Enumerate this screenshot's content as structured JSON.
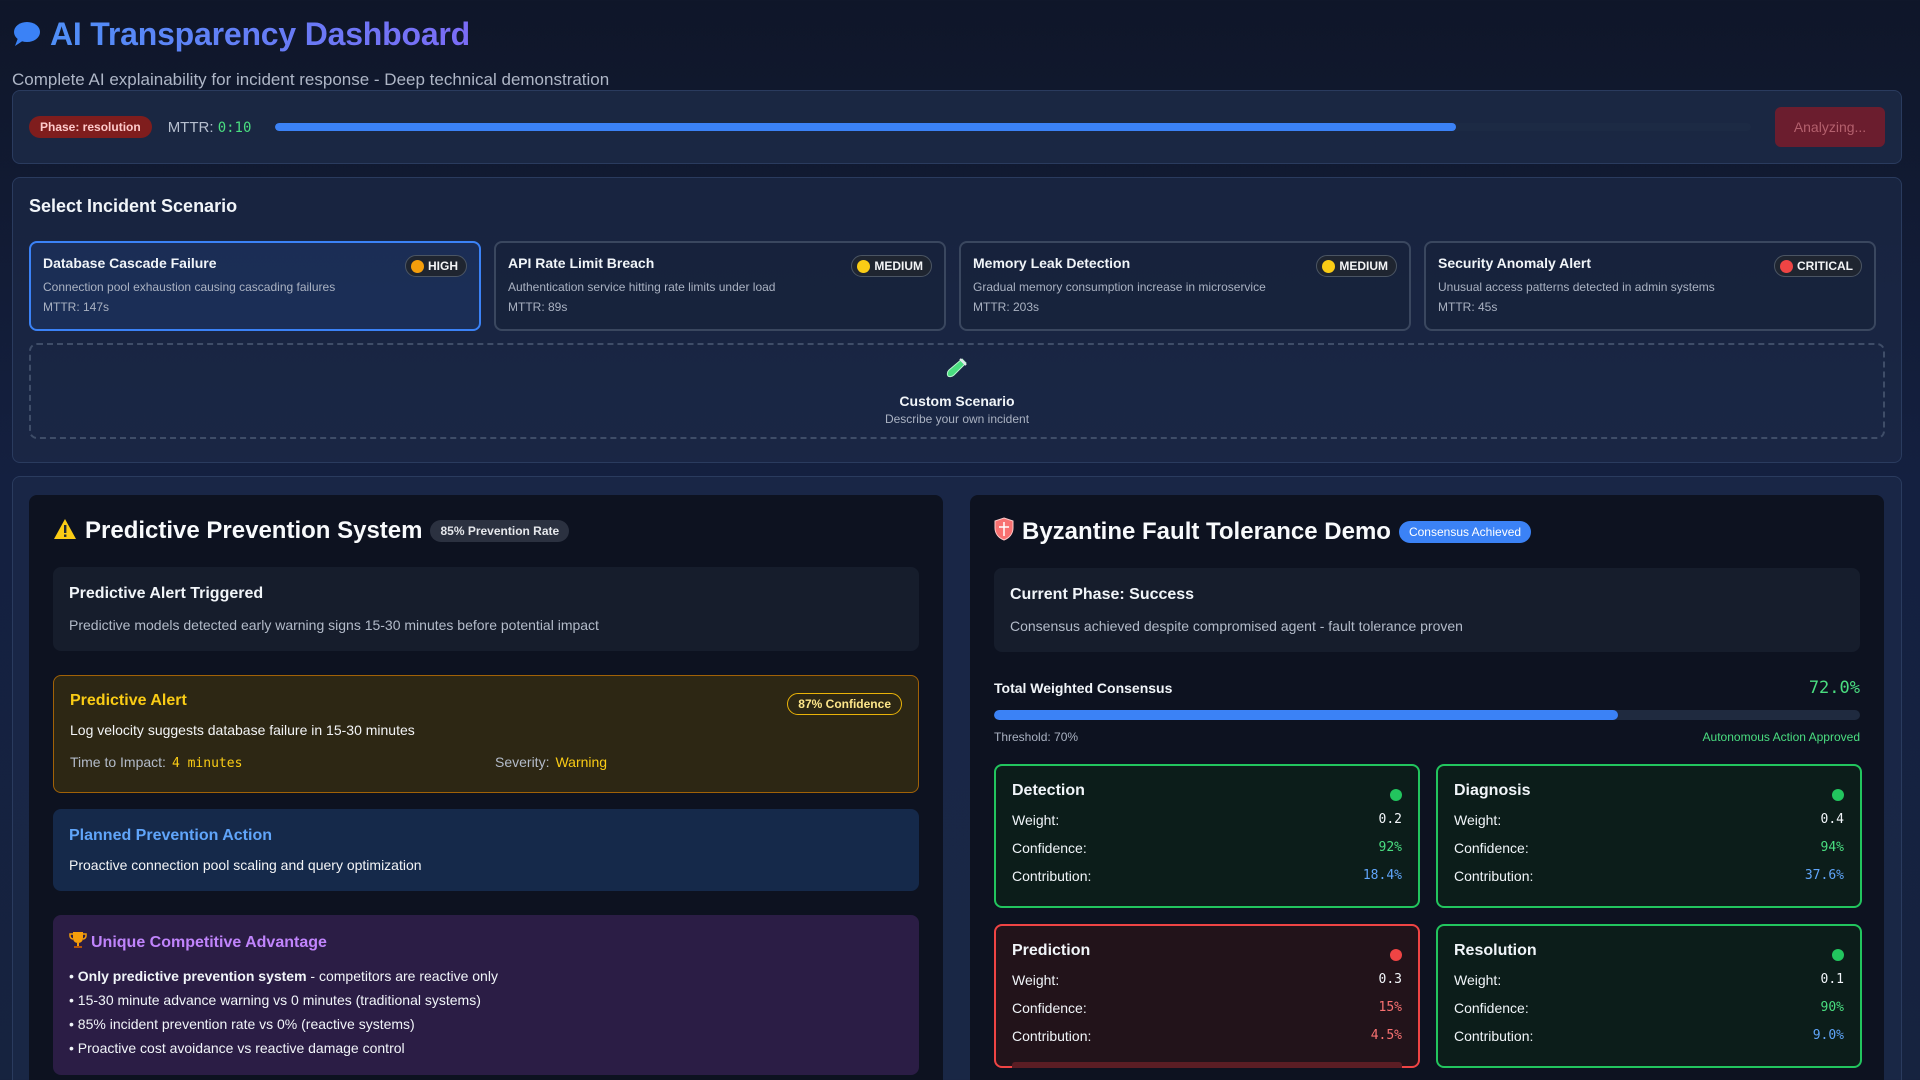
{
  "header": {
    "title": "AI Transparency Dashboard",
    "subtitle": "Complete AI explainability for incident response - Deep technical demonstration",
    "icon": "speech-bubble-icon"
  },
  "status": {
    "phase_badge": "Phase: resolution",
    "mttr_label": "MTTR:",
    "mttr_value": "0:10",
    "progress": 0.8,
    "button_label": "Analyzing..."
  },
  "scenarios": {
    "title": "Select Incident Scenario",
    "items": [
      {
        "title": "Database Cascade Failure",
        "severity": "HIGH",
        "severity_color": "#f59e0b",
        "description": "Connection pool exhaustion causing cascading failures",
        "mttr": "MTTR: 147s",
        "selected": true
      },
      {
        "title": "API Rate Limit Breach",
        "severity": "MEDIUM",
        "severity_color": "#facc15",
        "description": "Authentication service hitting rate limits under load",
        "mttr": "MTTR: 89s",
        "selected": false
      },
      {
        "title": "Memory Leak Detection",
        "severity": "MEDIUM",
        "severity_color": "#facc15",
        "description": "Gradual memory consumption increase in microservice",
        "mttr": "MTTR: 203s",
        "selected": false
      },
      {
        "title": "Security Anomaly Alert",
        "severity": "CRITICAL",
        "severity_color": "#ef4444",
        "description": "Unusual access patterns detected in admin systems",
        "mttr": "MTTR: 45s",
        "selected": false
      }
    ],
    "custom": {
      "title": "Custom Scenario",
      "subtitle": "Describe your own incident",
      "icon": "test-tube-icon"
    }
  },
  "prevention": {
    "title": "Predictive Prevention System",
    "badge": "85% Prevention Rate",
    "icon": "warning-icon",
    "triggered": {
      "title": "Predictive Alert Triggered",
      "description": "Predictive models detected early warning signs 15-30 minutes before potential impact"
    },
    "alert": {
      "title": "Predictive Alert",
      "confidence": "87% Confidence",
      "description": "Log velocity suggests database failure in 15-30 minutes",
      "time_label": "Time to Impact:",
      "time_value": "4 minutes",
      "severity_label": "Severity:",
      "severity_value": "Warning"
    },
    "action": {
      "title": "Planned Prevention Action",
      "description": "Proactive connection pool scaling and query optimization"
    },
    "advantage": {
      "icon": "trophy-icon",
      "title": "Unique Competitive Advantage",
      "items": [
        {
          "bold": "Only predictive prevention system",
          "text": " - competitors are reactive only"
        },
        {
          "bold": "",
          "text": "15-30 minute advance warning vs 0 minutes (traditional systems)"
        },
        {
          "bold": "",
          "text": "85% incident prevention rate vs 0% (reactive systems)"
        },
        {
          "bold": "",
          "text": "Proactive cost avoidance vs reactive damage control"
        }
      ]
    }
  },
  "byzantine": {
    "title": "Byzantine Fault Tolerance Demo",
    "badge": "Consensus Achieved",
    "icon": "shield-icon",
    "phase": {
      "title": "Current Phase: Success",
      "description": "Consensus achieved despite compromised agent - fault tolerance proven"
    },
    "consensus": {
      "label": "Total Weighted Consensus",
      "value": "72.0%",
      "fraction": 0.72,
      "threshold": "Threshold: 70%",
      "outcome": "Autonomous Action Approved"
    },
    "labels": {
      "weight": "Weight:",
      "confidence": "Confidence:",
      "contribution": "Contribution:"
    },
    "agents": [
      {
        "name": "Detection",
        "weight": "0.2",
        "confidence": "92%",
        "contribution": "18.4%",
        "healthy": true
      },
      {
        "name": "Diagnosis",
        "weight": "0.4",
        "confidence": "94%",
        "contribution": "37.6%",
        "healthy": true
      },
      {
        "name": "Prediction",
        "weight": "0.3",
        "confidence": "15%",
        "contribution": "4.5%",
        "healthy": false
      },
      {
        "name": "Resolution",
        "weight": "0.1",
        "confidence": "90%",
        "contribution": "9.0%",
        "healthy": true
      }
    ]
  }
}
